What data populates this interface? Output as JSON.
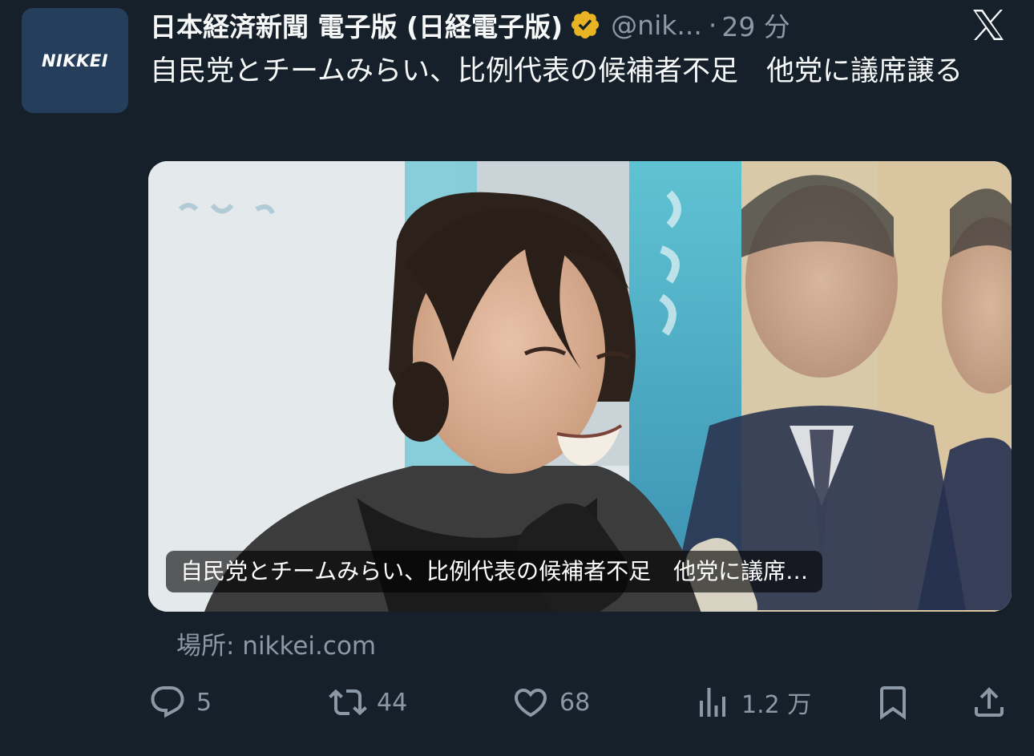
{
  "tweet": {
    "avatar_text": "NIKKEI",
    "display_name": "日本経済新聞 電子版 (日経電子版)",
    "handle": "@nik...",
    "separator": "·",
    "time": "29 分",
    "text": "自民党とチームみらい、比例代表の候補者不足　他党に議席譲る"
  },
  "card": {
    "caption": "自民党とチームみらい、比例代表の候補者不足　他党に議席…",
    "source": "場所: nikkei.com"
  },
  "actions": {
    "replies": "5",
    "reposts": "44",
    "likes": "68",
    "views": "1.2 万"
  },
  "colors": {
    "background": "#15202b",
    "text": "#f7f9f9",
    "secondary": "#8b98a5",
    "verified_gold": "#e8b423",
    "avatar_bg": "#243e5c"
  },
  "icons": [
    "verified-badge-icon",
    "x-logo-icon",
    "reply-icon",
    "repost-icon",
    "like-icon",
    "views-icon",
    "bookmark-icon",
    "share-icon"
  ]
}
